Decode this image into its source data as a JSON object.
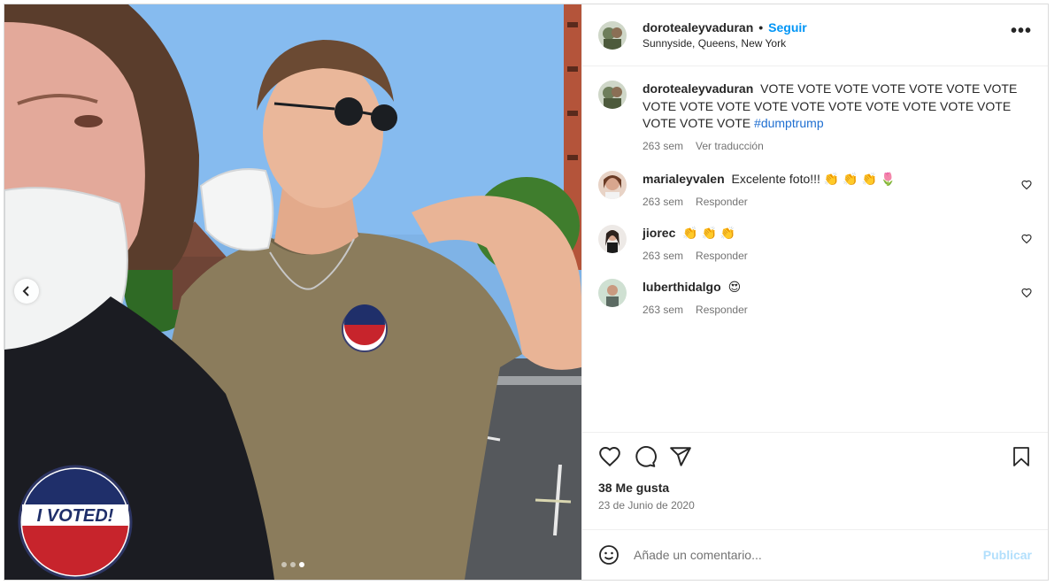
{
  "post": {
    "author": "dorotealeyvaduran",
    "separator": "•",
    "follow_label": "Seguir",
    "location": "Sunnyside, Queens, New York",
    "more_label": "•••",
    "slide_count": 3,
    "active_slide": 3,
    "caption": {
      "text": "VOTE VOTE VOTE VOTE VOTE VOTE VOTE VOTE VOTE VOTE VOTE VOTE VOTE VOTE VOTE VOTE VOTE VOTE VOTE VOTE",
      "hashtag": "#dumptrump",
      "age": "263 sem",
      "translate_label": "Ver traducción"
    },
    "comments": [
      {
        "username": "marialeyvalen",
        "text": "Excelente foto!!! 👏 👏 👏 🌷",
        "age": "263 sem",
        "reply_label": "Responder"
      },
      {
        "username": "jiorec",
        "text": "👏 👏 👏",
        "age": "263 sem",
        "reply_label": "Responder"
      },
      {
        "username": "luberthidalgo",
        "text": "😍",
        "age": "263 sem",
        "reply_label": "Responder"
      }
    ],
    "likes_label": "38 Me gusta",
    "date_label": "23 de Junio de 2020",
    "comment_placeholder": "Añade un comentario...",
    "publish_label": "Publicar"
  },
  "photo": {
    "sticker_text": "I VOTED!"
  },
  "colors": {
    "accent": "#0095f6",
    "publish_disabled": "#b2dffc",
    "muted": "#737373",
    "border": "#dbdbdb"
  },
  "icons": [
    "heart-icon",
    "comment-icon",
    "share-icon",
    "bookmark-icon",
    "emoji-icon",
    "more-options-icon",
    "chevron-left-icon"
  ]
}
